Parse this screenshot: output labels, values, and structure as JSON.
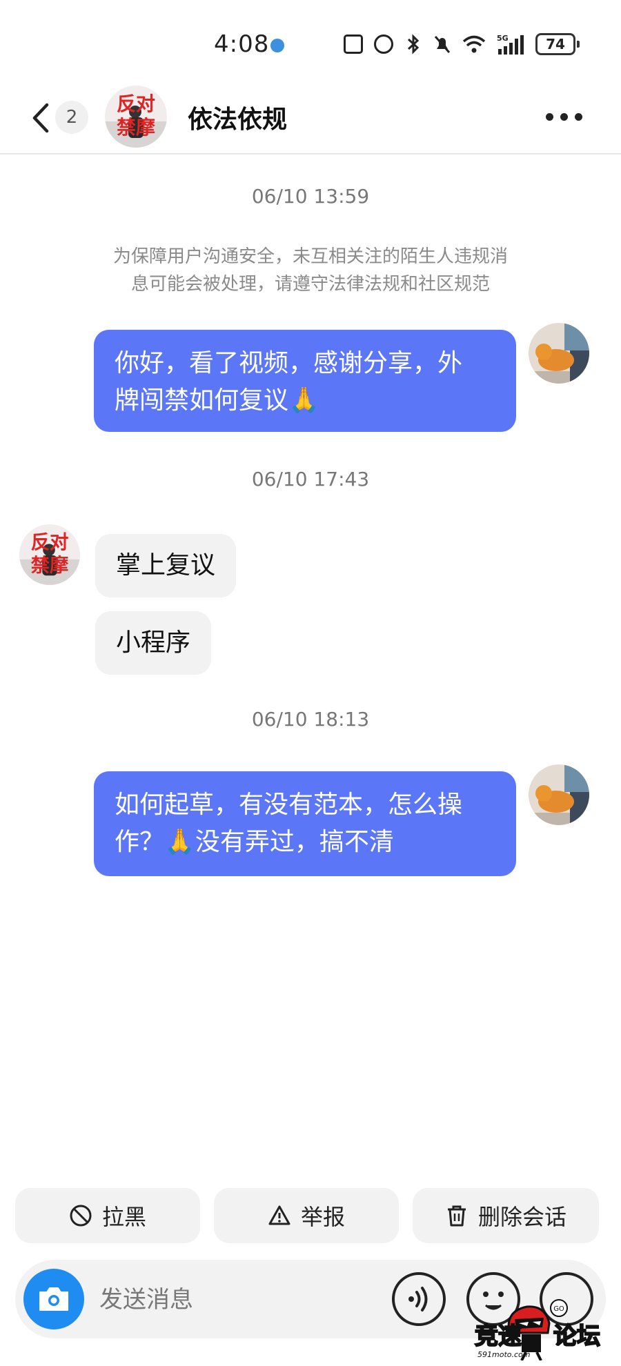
{
  "status_bar": {
    "time": "4:08",
    "battery": "74",
    "network": "5G"
  },
  "header": {
    "unread_count": "2",
    "title": "依法依规",
    "avatar_text_top": "反对",
    "avatar_text_bottom": "禁摩"
  },
  "chat": {
    "messages": [
      {
        "type": "timestamp",
        "text": "06/10 13:59"
      },
      {
        "type": "system",
        "text": "为保障用户沟通安全，未互相关注的陌生人违规消息可能会被处理，请遵守法律法规和社区规范"
      },
      {
        "type": "outgoing",
        "line1": "你好，看了视频，感谢分享，外",
        "line2": "牌闯禁如何复议",
        "emoji": "🙏"
      },
      {
        "type": "timestamp",
        "text": "06/10 17:43"
      },
      {
        "type": "incoming",
        "text": "掌上复议"
      },
      {
        "type": "incoming",
        "text": "小程序"
      },
      {
        "type": "timestamp",
        "text": "06/10 18:13"
      },
      {
        "type": "outgoing",
        "line1": "如何起草，有没有范本，怎么操",
        "line2_a": "作？",
        "line2_emoji": "🙏",
        "line2_b": "没有弄过，搞不清"
      }
    ],
    "system_line1": "为保障用户沟通安全，未互相关注的陌生人违规消",
    "system_line2": "息可能会被处理，请遵守法律法规和社区规范"
  },
  "actions": {
    "block_label": "拉黑",
    "report_label": "举报",
    "delete_label": "删除会话"
  },
  "composer": {
    "placeholder": "发送消息"
  },
  "watermark": {
    "text_left": "竞速",
    "text_right": "论坛",
    "site": "591moto.com"
  },
  "colors": {
    "outgoing_bubble": "#5b77f7",
    "incoming_bubble": "#f2f2f2",
    "camera_button": "#1e8cf0"
  }
}
